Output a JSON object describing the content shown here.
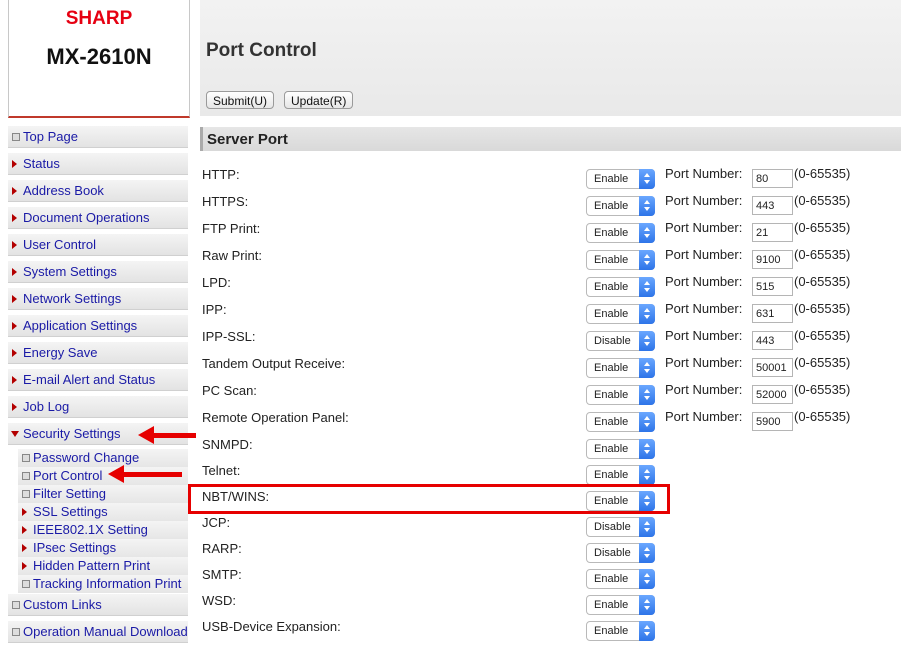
{
  "brand": "SHARP",
  "model": "MX-2610N",
  "page_title": "Port Control",
  "buttons": {
    "submit": "Submit(U)",
    "update": "Update(R)"
  },
  "section_title": "Server Port",
  "port_number_label": "Port Number:",
  "port_range": "(0-65535)",
  "sidebar": {
    "top": [
      {
        "label": "Top Page",
        "icon": "square"
      },
      {
        "label": "Status",
        "icon": "triangle-right"
      },
      {
        "label": "Address Book",
        "icon": "triangle-right"
      },
      {
        "label": "Document Operations",
        "icon": "triangle-right"
      },
      {
        "label": "User Control",
        "icon": "triangle-right"
      },
      {
        "label": "System Settings",
        "icon": "triangle-right"
      },
      {
        "label": "Network Settings",
        "icon": "triangle-right"
      },
      {
        "label": "Application Settings",
        "icon": "triangle-right"
      },
      {
        "label": "Energy Save",
        "icon": "triangle-right"
      },
      {
        "label": "E-mail Alert and Status",
        "icon": "triangle-right"
      },
      {
        "label": "Job Log",
        "icon": "triangle-right"
      },
      {
        "label": "Security Settings",
        "icon": "triangle-down"
      }
    ],
    "sub": [
      {
        "label": "Password Change",
        "icon": "square"
      },
      {
        "label": "Port Control",
        "icon": "square"
      },
      {
        "label": "Filter Setting",
        "icon": "square"
      },
      {
        "label": "SSL Settings",
        "icon": "triangle-right"
      },
      {
        "label": "IEEE802.1X Setting",
        "icon": "triangle-right"
      },
      {
        "label": "IPsec Settings",
        "icon": "triangle-right"
      },
      {
        "label": "Hidden Pattern Print",
        "icon": "triangle-right"
      },
      {
        "label": "Tracking Information Print",
        "icon": "square"
      }
    ],
    "bottom": [
      {
        "label": "Custom Links",
        "icon": "square"
      },
      {
        "label": "Operation Manual Download",
        "icon": "square"
      }
    ]
  },
  "rows": [
    {
      "label": "HTTP:",
      "value": "Enable",
      "port": "80"
    },
    {
      "label": "HTTPS:",
      "value": "Enable",
      "port": "443"
    },
    {
      "label": "FTP Print:",
      "value": "Enable",
      "port": "21"
    },
    {
      "label": "Raw Print:",
      "value": "Enable",
      "port": "9100"
    },
    {
      "label": "LPD:",
      "value": "Enable",
      "port": "515"
    },
    {
      "label": "IPP:",
      "value": "Enable",
      "port": "631"
    },
    {
      "label": "IPP-SSL:",
      "value": "Disable",
      "port": "443"
    },
    {
      "label": "Tandem Output Receive:",
      "value": "Enable",
      "port": "50001"
    },
    {
      "label": "PC Scan:",
      "value": "Enable",
      "port": "52000"
    },
    {
      "label": "Remote Operation Panel:",
      "value": "Enable",
      "port": "5900"
    },
    {
      "label": "SNMPD:",
      "value": "Enable"
    },
    {
      "label": "Telnet:",
      "value": "Enable"
    },
    {
      "label": "NBT/WINS:",
      "value": "Enable"
    },
    {
      "label": "JCP:",
      "value": "Disable"
    },
    {
      "label": "RARP:",
      "value": "Disable"
    },
    {
      "label": "SMTP:",
      "value": "Enable"
    },
    {
      "label": "WSD:",
      "value": "Enable"
    },
    {
      "label": "USB-Device Expansion:",
      "value": "Enable"
    }
  ],
  "colors": {
    "brand_red": "#e60012",
    "link_blue": "#1a1aa6",
    "annotation_red": "#e60000",
    "select_arrow_blue": "#2d74e8"
  }
}
